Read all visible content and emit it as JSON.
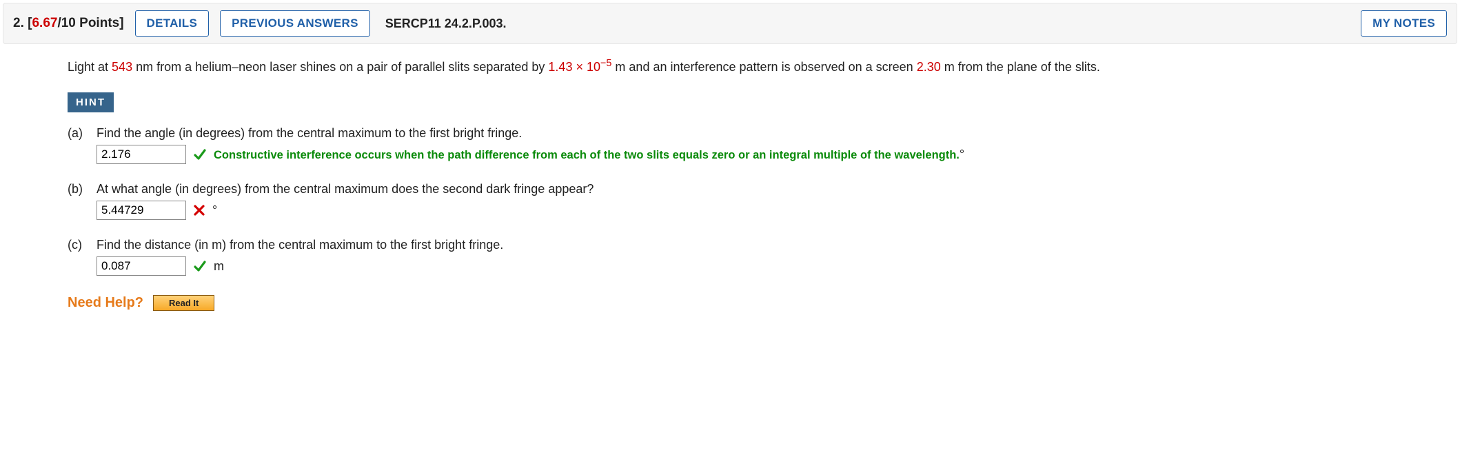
{
  "header": {
    "number": "2.",
    "score": "6.67",
    "max": "10",
    "points_suffix": " Points]",
    "details_btn": "DETAILS",
    "previous_btn": "PREVIOUS ANSWERS",
    "assignment_id": "SERCP11 24.2.P.003.",
    "mynotes_btn": "MY NOTES"
  },
  "prompt": {
    "p1": "Light at ",
    "wavelength": "543",
    "p2": " nm from a helium–neon laser shines on a pair of parallel slits separated by ",
    "sep_base": "1.43 × 10",
    "sep_exp": "−5",
    "p3": " m and an interference pattern is observed on a screen ",
    "distance": "2.30",
    "p4": " m from the plane of the slits."
  },
  "hint_label": "HINT",
  "parts": {
    "a": {
      "label": "(a)",
      "text": "Find the angle (in degrees) from the central maximum to the first bright fringe.",
      "value": "2.176",
      "feedback": "Constructive interference occurs when the path difference from each of the two slits equals zero or an integral multiple of the wavelength.",
      "unit": "°"
    },
    "b": {
      "label": "(b)",
      "text": "At what angle (in degrees) from the central maximum does the second dark fringe appear?",
      "value": "5.44729",
      "unit": "°"
    },
    "c": {
      "label": "(c)",
      "text": "Find the distance (in m) from the central maximum to the first bright fringe.",
      "value": "0.087",
      "unit": "m"
    }
  },
  "help": {
    "label": "Need Help?",
    "readit": "Read It"
  }
}
